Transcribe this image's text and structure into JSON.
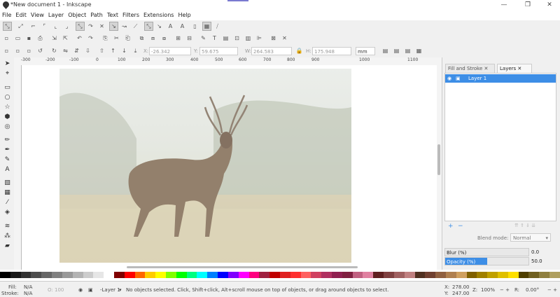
{
  "window": {
    "title": "*New document 1 - Inkscape",
    "minimize": "—",
    "restore": "❐",
    "close": "✕"
  },
  "menu": [
    "File",
    "Edit",
    "View",
    "Layer",
    "Object",
    "Path",
    "Text",
    "Filters",
    "Extensions",
    "Help"
  ],
  "toolcontrols": {
    "x_label": "X:",
    "x_value": "-26.342",
    "y_label": "Y:",
    "y_value": "59.675",
    "w_label": "W:",
    "w_value": "264.583",
    "h_label": "H:",
    "h_value": "175.948",
    "unit": "mm"
  },
  "ruler_ticks": [
    "-300",
    "-200",
    "-100",
    "0",
    "100",
    "200",
    "300",
    "400",
    "500",
    "600",
    "700",
    "800",
    "900",
    "1000",
    "1100"
  ],
  "dock": {
    "tab_fill": "Fill and Stroke",
    "tab_layers": "Layers",
    "layer_name": "Layer 1",
    "blend_label": "Blend mode:",
    "blend_value": "Normal",
    "blur_label": "Blur (%)",
    "blur_value": "0.0",
    "opacity_label": "Opacity (%)",
    "opacity_value": "50.0",
    "opacity_fraction": 0.5
  },
  "palette_colors": [
    "#000000",
    "#1a1a1a",
    "#333333",
    "#4d4d4d",
    "#666666",
    "#808080",
    "#999999",
    "#b3b3b3",
    "#cccccc",
    "#e6e6e6",
    "#ffffff",
    "#800000",
    "#ff0000",
    "#ff6600",
    "#ffcc00",
    "#ffff00",
    "#80ff00",
    "#00ff00",
    "#00ff80",
    "#00ffff",
    "#0080ff",
    "#0000ff",
    "#8000ff",
    "#ff00ff",
    "#ff0080",
    "#a02040",
    "#c00000",
    "#e02020",
    "#ff3030",
    "#ff6060",
    "#d04060",
    "#b03060",
    "#902050",
    "#802040",
    "#c06080",
    "#e080a0",
    "#602020",
    "#804040",
    "#a06060",
    "#c08080",
    "#503020",
    "#704030",
    "#906040",
    "#b08050",
    "#d0a060",
    "#806000",
    "#a08000",
    "#c0a000",
    "#e0c000",
    "#ffe000",
    "#504000",
    "#706020",
    "#908040",
    "#b0a060"
  ],
  "status": {
    "fill_label": "Fill:",
    "fill_value": "N/A",
    "stroke_label": "Stroke:",
    "stroke_value": "N/A",
    "opacity_label": "O:",
    "opacity_value": "100",
    "layer": "-Layer 1",
    "message": "No objects selected. Click, Shift+click, Alt+scroll mouse on top of objects, or drag around objects to select.",
    "x_label": "X:",
    "x": "278.00",
    "y_label": "Y:",
    "y": "247.00",
    "z_label": "Z:",
    "zoom": "100%",
    "r_label": "R:",
    "rotation": "0.00°"
  }
}
